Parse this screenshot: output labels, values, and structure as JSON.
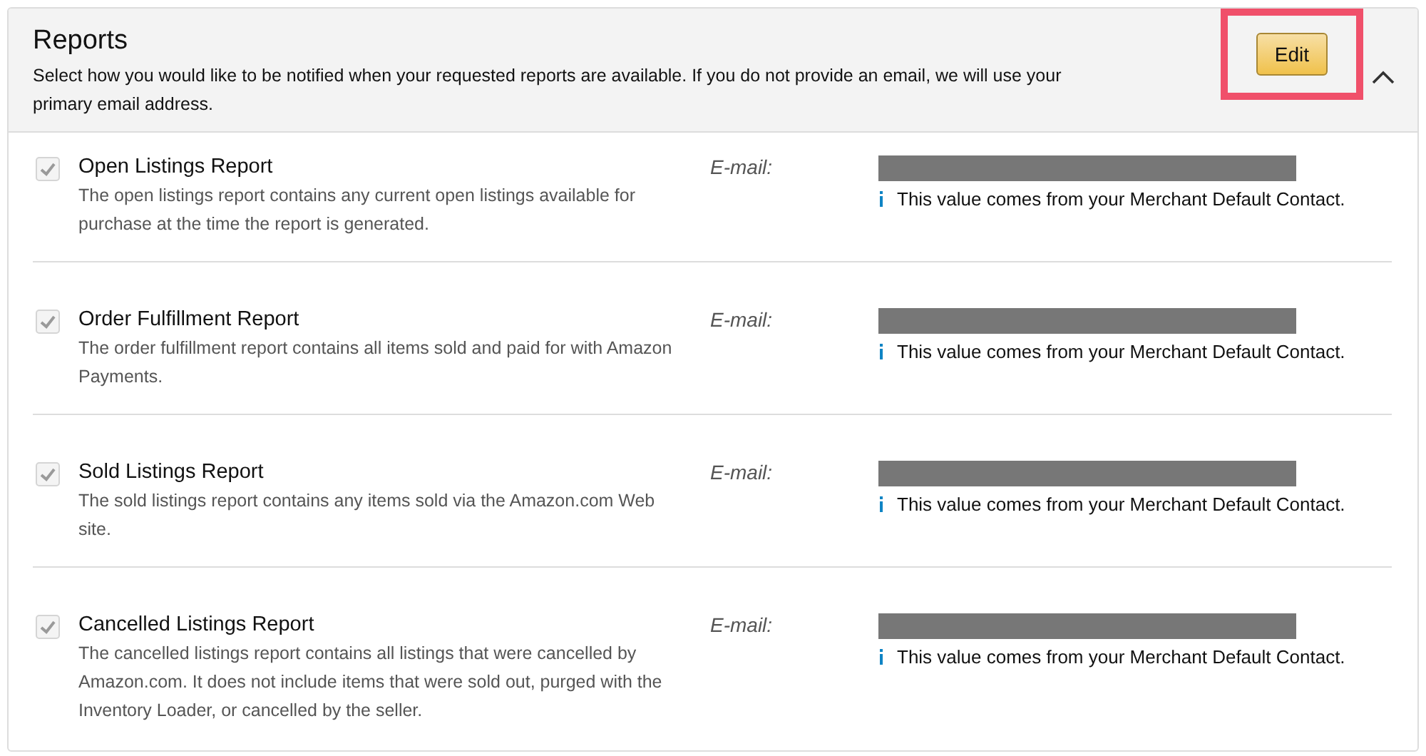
{
  "panel": {
    "title": "Reports",
    "description": "Select how you would like to be notified when your requested reports are available. If you do not provide an email, we will use your primary email address.",
    "edit_button": "Edit",
    "expanded": true
  },
  "reports": [
    {
      "name": "Open Listings Report",
      "description": "The open listings report contains any current open listings available for purchase at the time the report is generated.",
      "checked": true,
      "disabled": true,
      "email_label": "E-mail:",
      "note": "This value comes from your Merchant Default Contact."
    },
    {
      "name": "Order Fulfillment Report",
      "description": "The order fulfillment report contains all items sold and paid for with Amazon Payments.",
      "checked": true,
      "disabled": true,
      "email_label": "E-mail:",
      "note": "This value comes from your Merchant Default Contact."
    },
    {
      "name": "Sold Listings Report",
      "description": "The sold listings report contains any items sold via the Amazon.com Web site.",
      "checked": true,
      "disabled": true,
      "email_label": "E-mail:",
      "note": "This value comes from your Merchant Default Contact."
    },
    {
      "name": "Cancelled Listings Report",
      "description": "The cancelled listings report contains all listings that were cancelled by Amazon.com. It does not include items that were sold out, purged with the Inventory Loader, or cancelled by the seller.",
      "checked": true,
      "disabled": true,
      "email_label": "E-mail:",
      "note": "This value comes from your Merchant Default Contact."
    }
  ]
}
